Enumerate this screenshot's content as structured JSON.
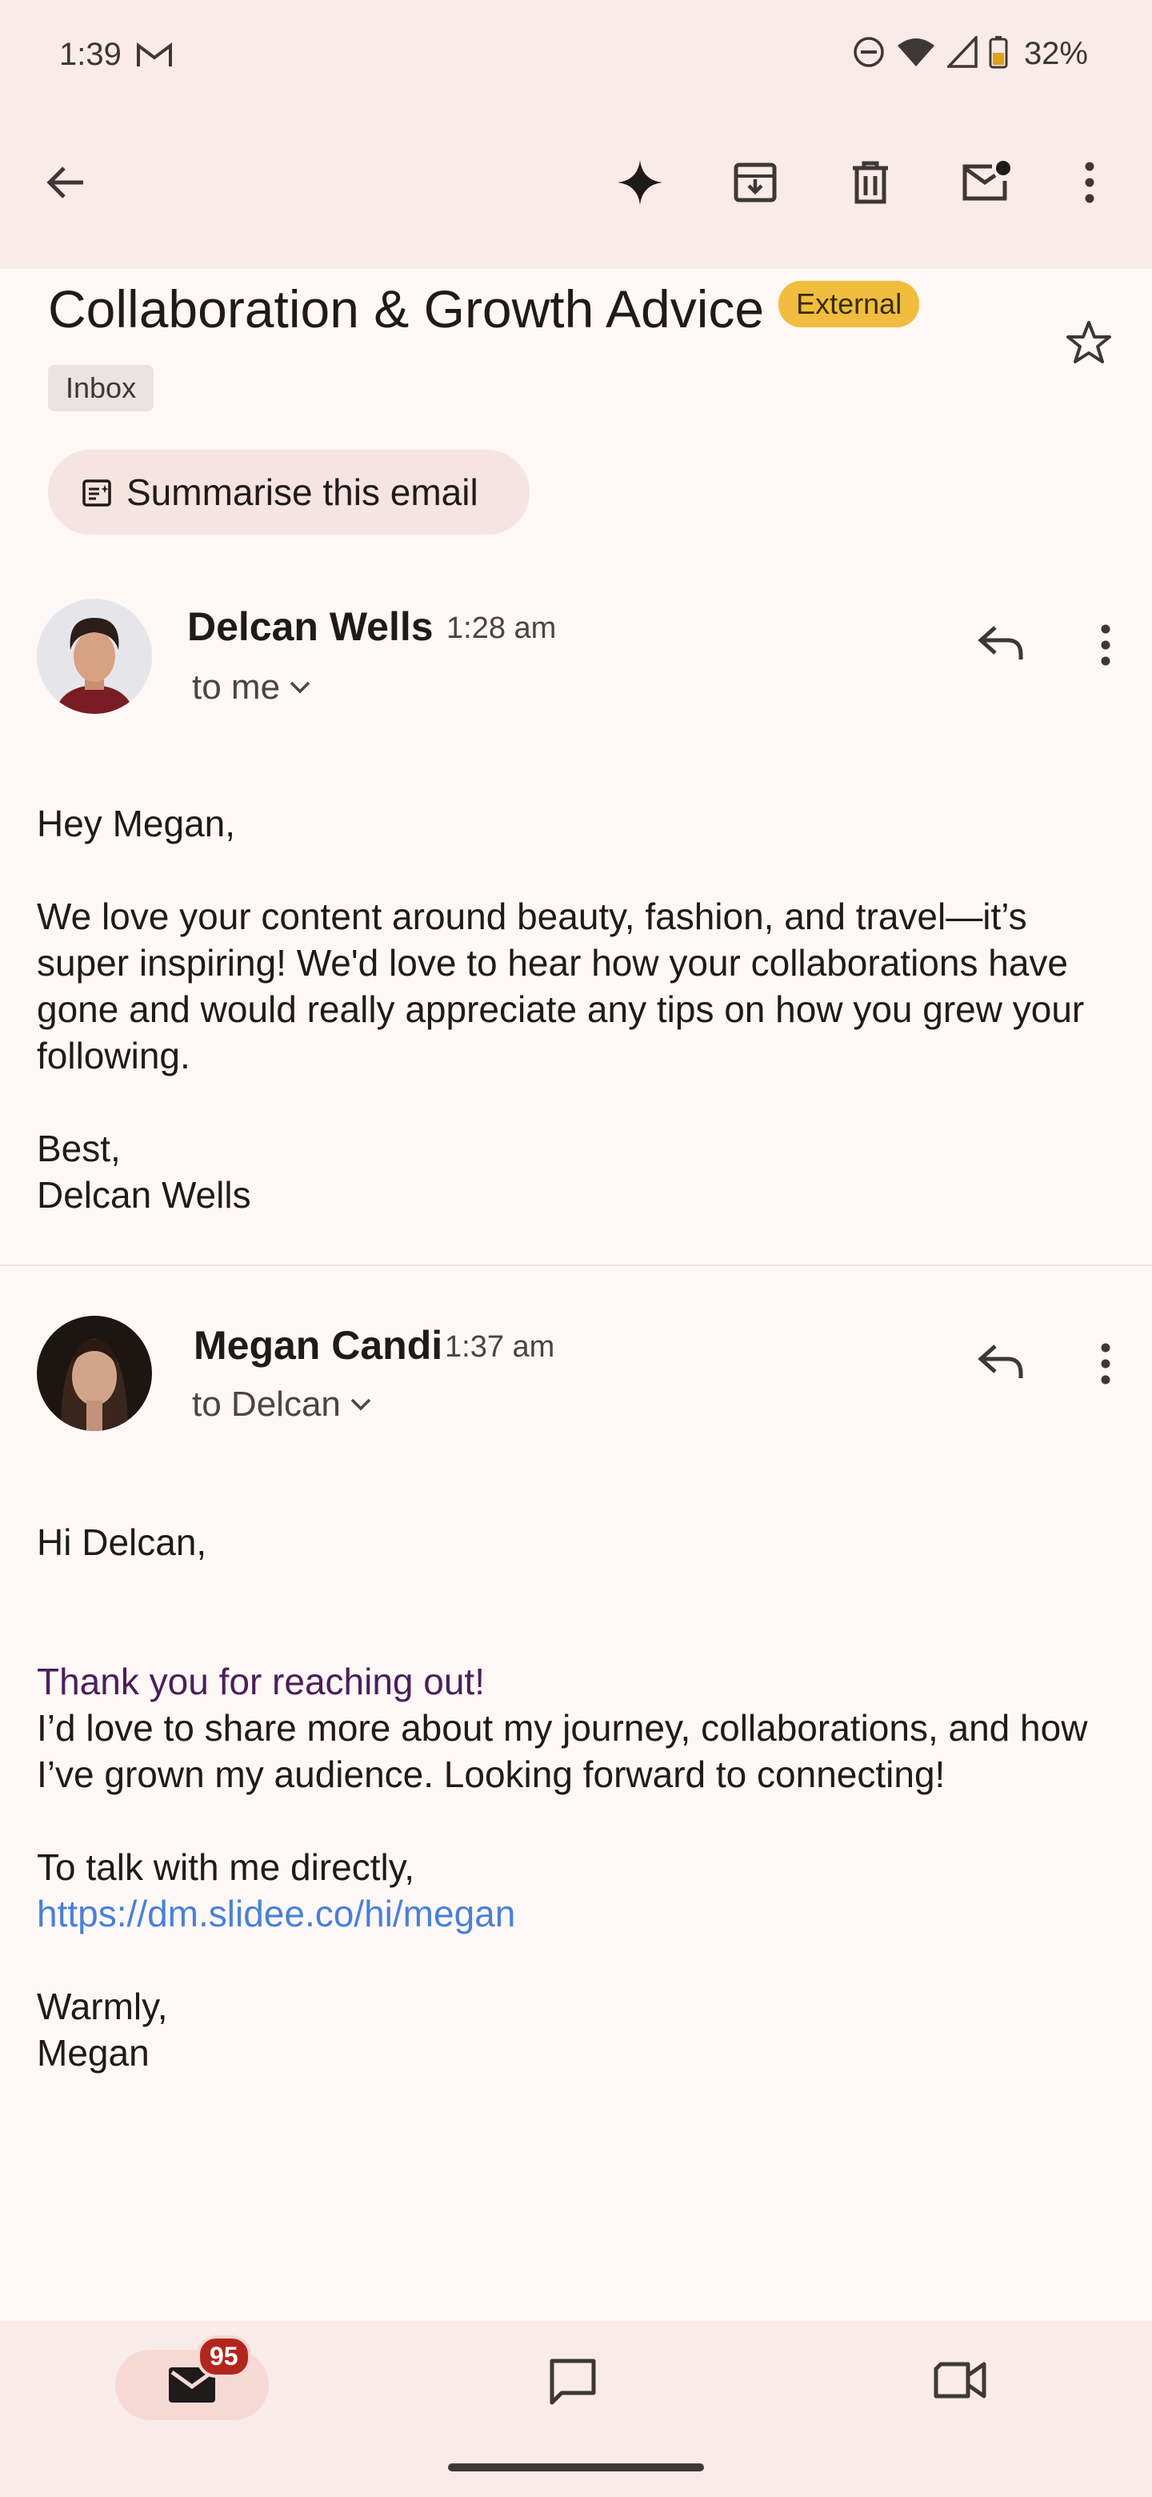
{
  "status": {
    "time": "1:39",
    "battery": "32%"
  },
  "toolbar": {
    "back_icon": "arrow-back-icon",
    "gemini_icon": "sparkle-icon",
    "archive_icon": "archive-icon",
    "delete_icon": "trash-icon",
    "unread_icon": "mark-unread-icon",
    "more_icon": "more-vert-icon"
  },
  "email": {
    "subject": "Collaboration & Growth Advice",
    "external_label": "External",
    "folder_label": "Inbox",
    "summarise_label": "Summarise this email"
  },
  "messages": [
    {
      "sender": "Delcan Wells",
      "time": "1:28 am",
      "recipient": "to me",
      "body": {
        "greeting": "Hey Megan,",
        "paragraph": "We love your content around beauty, fashion, and travel—it’s super inspiring! We'd love to hear how your collaborations have gone and would really appreciate any tips on how you grew your following.",
        "signoff": "Best,",
        "signature": "Delcan Wells"
      }
    },
    {
      "sender": "Megan Candi",
      "time": "1:37 am",
      "recipient": "to Delcan",
      "body": {
        "greeting": "Hi Delcan,",
        "highlight": "Thank you for reaching out!",
        "paragraph": "I’d love to share more about my journey, collaborations, and how I’ve grown my audience. Looking forward to connecting!",
        "cta": "To talk with me directly,",
        "link": "https://dm.slidee.co/hi/megan",
        "signoff": "Warmly,",
        "signature": "Megan"
      }
    }
  ],
  "bottom_nav": {
    "mail_badge": "95"
  },
  "colors": {
    "accent_badge": "#f0bd3e",
    "link": "#4a80d8",
    "unread_badge": "#b3261e"
  }
}
